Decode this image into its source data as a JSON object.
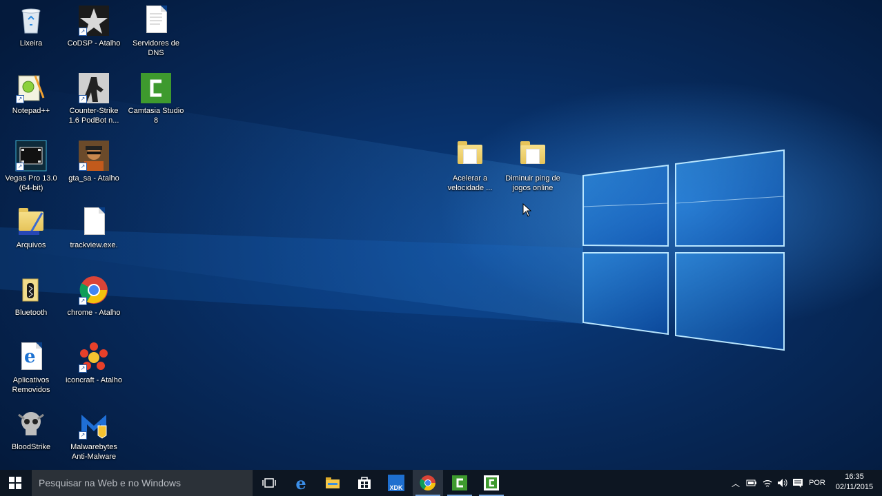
{
  "desktop": {
    "icons": [
      {
        "label": "Lixeira",
        "icon": "recycle-bin-icon"
      },
      {
        "label": "CoDSP - Atalho",
        "icon": "star-icon"
      },
      {
        "label": "Servidores de DNS",
        "icon": "text-document-icon"
      },
      {
        "label": "Notepad++",
        "icon": "notepad-plus-plus-icon"
      },
      {
        "label": "Counter-Strike 1.6 PodBot n...",
        "icon": "counter-strike-icon"
      },
      {
        "label": "Camtasia Studio 8",
        "icon": "camtasia-icon"
      },
      {
        "label": "Vegas Pro 13.0 (64-bit)",
        "icon": "vegas-pro-icon"
      },
      {
        "label": "gta_sa - Atalho",
        "icon": "gta-sa-icon"
      },
      {
        "label": "Arquivos",
        "icon": "folder-icon"
      },
      {
        "label": "trackview.exe.",
        "icon": "blank-file-icon"
      },
      {
        "label": "Bluetooth",
        "icon": "bluetooth-folder-icon"
      },
      {
        "label": "chrome - Atalho",
        "icon": "chrome-icon"
      },
      {
        "label": "Aplicativos Removidos",
        "icon": "edge-html-file-icon"
      },
      {
        "label": "iconcraft - Atalho",
        "icon": "iconcraft-icon"
      },
      {
        "label": "BloodStrike",
        "icon": "skull-icon"
      },
      {
        "label": "Malwarebytes Anti-Malware",
        "icon": "malwarebytes-icon"
      },
      {
        "label": "Acelerar a velocidade ...",
        "icon": "folder-icon"
      },
      {
        "label": "Diminuir ping de jogos online",
        "icon": "folder-icon"
      }
    ]
  },
  "taskbar": {
    "search_placeholder": "Pesquisar na Web e no Windows",
    "pinned": [
      {
        "name": "task-view-icon"
      },
      {
        "name": "edge-icon"
      },
      {
        "name": "file-explorer-icon"
      },
      {
        "name": "store-icon"
      },
      {
        "name": "intel-xdk-icon",
        "text": "XDK"
      },
      {
        "name": "chrome-icon"
      },
      {
        "name": "camtasia-icon"
      },
      {
        "name": "camtasia-recorder-icon"
      }
    ],
    "tray": {
      "language": "POR",
      "time": "16:35",
      "date": "02/11/2015"
    }
  },
  "colors": {
    "taskbar": "#0d1622",
    "search_box": "#2b3138",
    "accent": "#79a8e0",
    "wallpaper": "#0a3f86"
  }
}
